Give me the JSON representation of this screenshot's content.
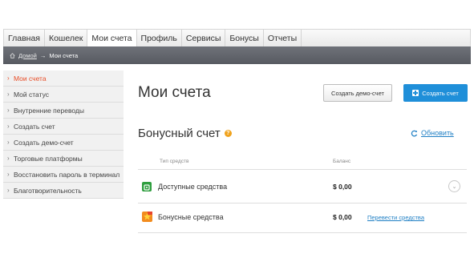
{
  "topnav": {
    "tabs": [
      {
        "label": "Главная"
      },
      {
        "label": "Кошелек"
      },
      {
        "label": "Мои счета",
        "active": true
      },
      {
        "label": "Профиль"
      },
      {
        "label": "Сервисы"
      },
      {
        "label": "Бонусы"
      },
      {
        "label": "Отчеты"
      }
    ]
  },
  "breadcrumb": {
    "home_label": "Домой",
    "separator": "→",
    "current": "Мои счета"
  },
  "sidebar": {
    "chevron": "›",
    "items": [
      {
        "label": "Мои счета",
        "active": true
      },
      {
        "label": "Мой статус"
      },
      {
        "label": "Внутренние переводы"
      },
      {
        "label": "Создать счет"
      },
      {
        "label": "Создать демо-счет"
      },
      {
        "label": "Торговые платформы"
      },
      {
        "label": "Восстановить пароль в терминал"
      },
      {
        "label": "Благотворительность"
      }
    ]
  },
  "main": {
    "title": "Мои счета",
    "demo_button": "Создать демо-счет",
    "create_button": "Создать счет",
    "section_title": "Бонусный счет",
    "help_glyph": "?",
    "refresh_label": "Обновить",
    "table": {
      "headers": {
        "type": "Тип средств",
        "balance": "Баланс"
      },
      "rows": [
        {
          "label": "Доступные средства",
          "amount": "$ 0,00",
          "icon": "wallet-icon"
        },
        {
          "label": "Бонусные средства",
          "amount": "$ 0,00",
          "link": "Перевести средства",
          "icon": "bonus-star-icon"
        }
      ],
      "expand_glyph": "⌄"
    }
  },
  "colors": {
    "accent_blue": "#1f8fd9",
    "active_orange": "#e84d27",
    "help_orange": "#f0a21c",
    "wallet_green": "#2e9e3e"
  }
}
